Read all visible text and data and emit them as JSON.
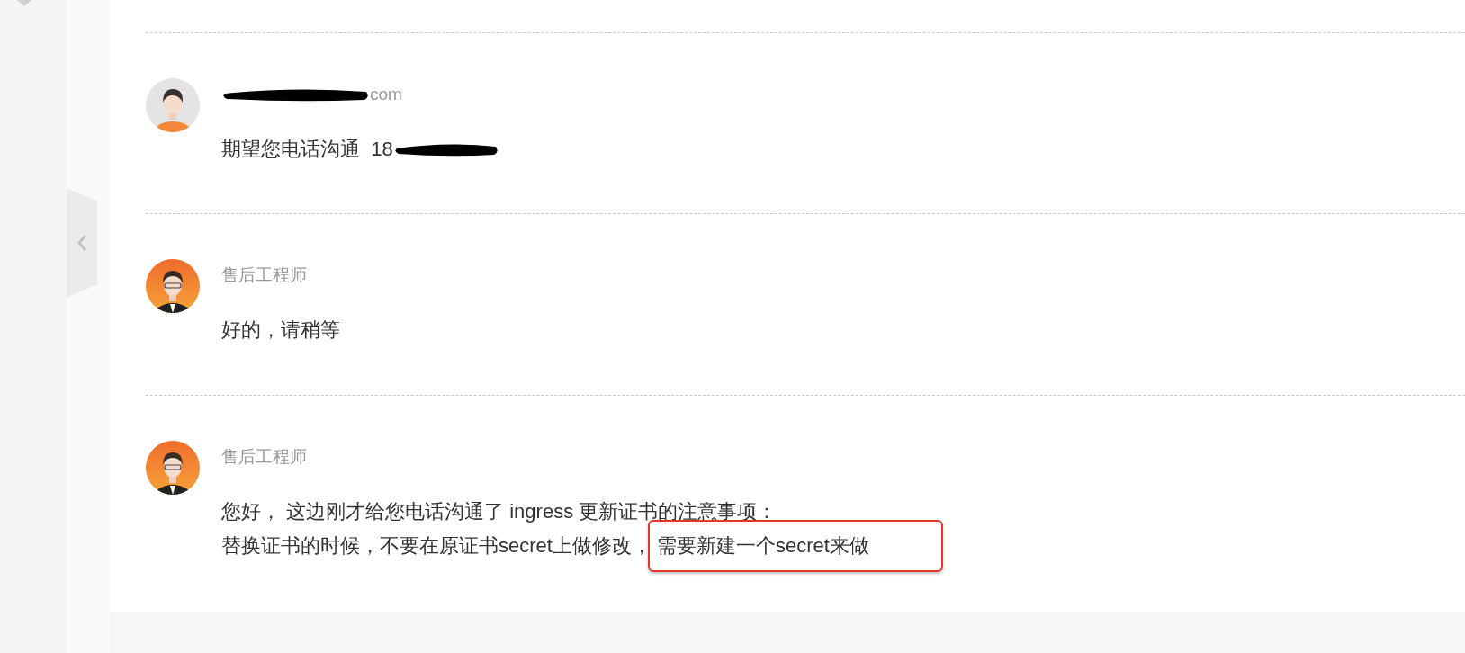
{
  "messages": [
    {
      "author": "com",
      "author_redacted": true,
      "kind": "customer",
      "body": [
        [
          {
            "text": "期望您电话沟通  18",
            "highlighted": false,
            "redacted_after": true
          }
        ]
      ]
    },
    {
      "author": "售后工程师",
      "author_redacted": false,
      "kind": "engineer",
      "body": [
        [
          {
            "text": "好的，请稍等",
            "highlighted": false,
            "redacted_after": false
          }
        ]
      ]
    },
    {
      "author": "售后工程师",
      "author_redacted": false,
      "kind": "engineer",
      "body": [
        [
          {
            "text": "您好， 这边刚才给您电话沟通了 ingress 更新证书的注意事项：",
            "highlighted": false,
            "redacted_after": false
          }
        ],
        [
          {
            "text": "替换证书的时候，不要在原证书secret上做修改，",
            "highlighted": false,
            "redacted_after": false
          },
          {
            "text": "需要新建一个secret来做",
            "highlighted": true,
            "redacted_after": false
          }
        ]
      ]
    }
  ]
}
